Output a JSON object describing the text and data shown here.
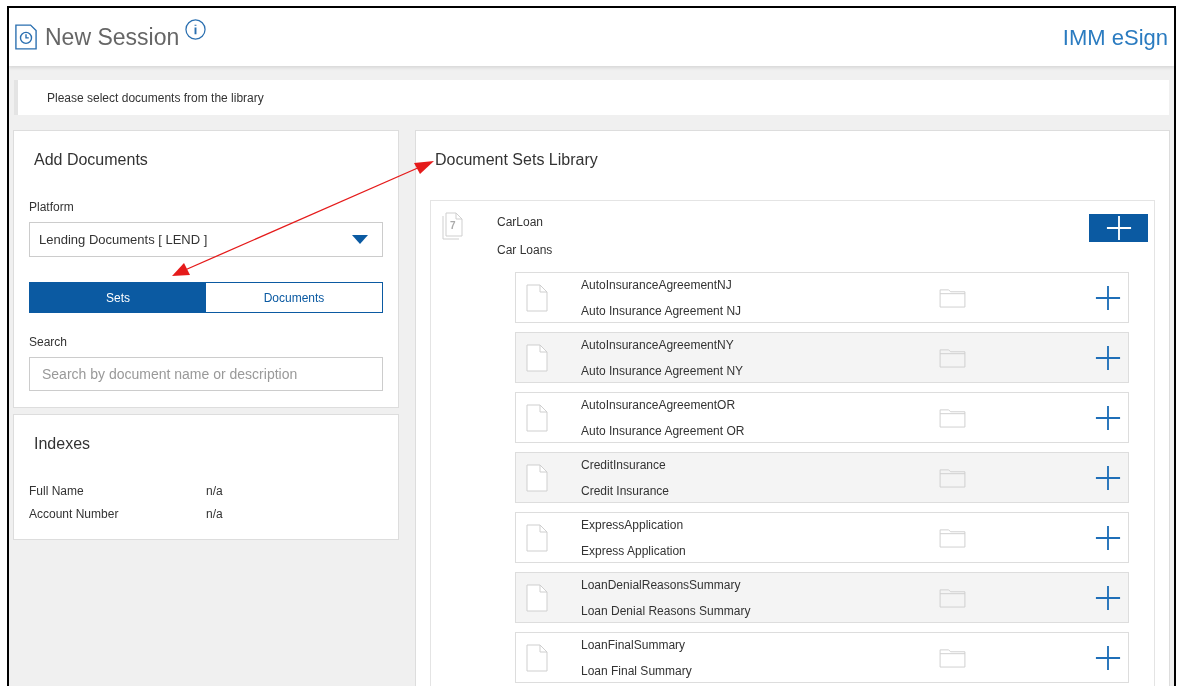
{
  "header": {
    "title": "New Session",
    "brand": "IMM eSign"
  },
  "message": "Please select documents from the library",
  "add_documents": {
    "title": "Add Documents",
    "platform_label": "Platform",
    "platform_value": "Lending Documents [ LEND ]",
    "tabs": [
      {
        "label": "Sets",
        "selected": true
      },
      {
        "label": "Documents",
        "selected": false
      }
    ],
    "search_label": "Search",
    "search": {
      "placeholder": "Search by document name or description"
    }
  },
  "indexes": {
    "title": "Indexes",
    "rows": [
      {
        "label": "Full Name",
        "value": "n/a"
      },
      {
        "label": "Account Number",
        "value": "n/a"
      }
    ]
  },
  "library": {
    "title": "Document Sets Library",
    "set": {
      "badge": "7",
      "name": "CarLoan",
      "description": "Car Loans"
    },
    "documents": [
      {
        "name": "AutoInsuranceAgreementNJ",
        "description": "Auto Insurance Agreement NJ"
      },
      {
        "name": "AutoInsuranceAgreementNY",
        "description": "Auto Insurance Agreement NY"
      },
      {
        "name": "AutoInsuranceAgreementOR",
        "description": "Auto Insurance Agreement OR"
      },
      {
        "name": "CreditInsurance",
        "description": "Credit Insurance"
      },
      {
        "name": "ExpressApplication",
        "description": "Express Application"
      },
      {
        "name": "LoanDenialReasonsSummary",
        "description": "Loan Denial Reasons Summary"
      },
      {
        "name": "LoanFinalSummary",
        "description": "Loan Final Summary"
      }
    ]
  }
}
